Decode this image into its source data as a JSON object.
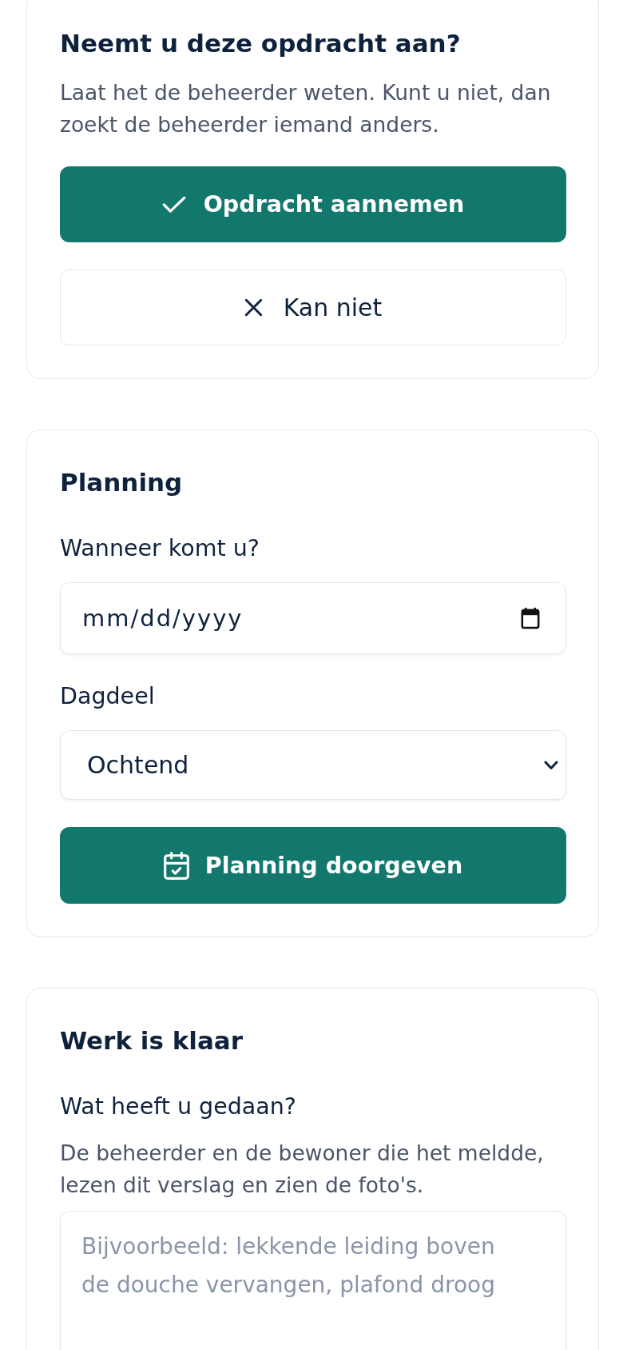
{
  "accept_card": {
    "title": "Neemt u deze opdracht aan?",
    "description": "Laat het de beheerder weten. Kunt u niet, dan zoekt de beheerder iemand anders.",
    "accept_button": {
      "label": "Opdracht aannemen"
    },
    "decline_button": {
      "label": "Kan niet"
    }
  },
  "planning_card": {
    "title": "Planning",
    "date_field": {
      "label": "Wanneer komt u?",
      "placeholder": "mm/dd/yyyy"
    },
    "daypart_field": {
      "label": "Dagdeel",
      "value": "Ochtend"
    },
    "submit_button": {
      "label": "Planning doorgeven"
    }
  },
  "report_card": {
    "title": "Werk is klaar",
    "report_field": {
      "label": "Wat heeft u gedaan?",
      "help": "De beheerder en de bewoner die het meldde, lezen dit verslag en zien de foto's.",
      "placeholder": "Bijvoorbeeld: lekkende leiding boven de douche vervangen, plafond droog"
    }
  }
}
